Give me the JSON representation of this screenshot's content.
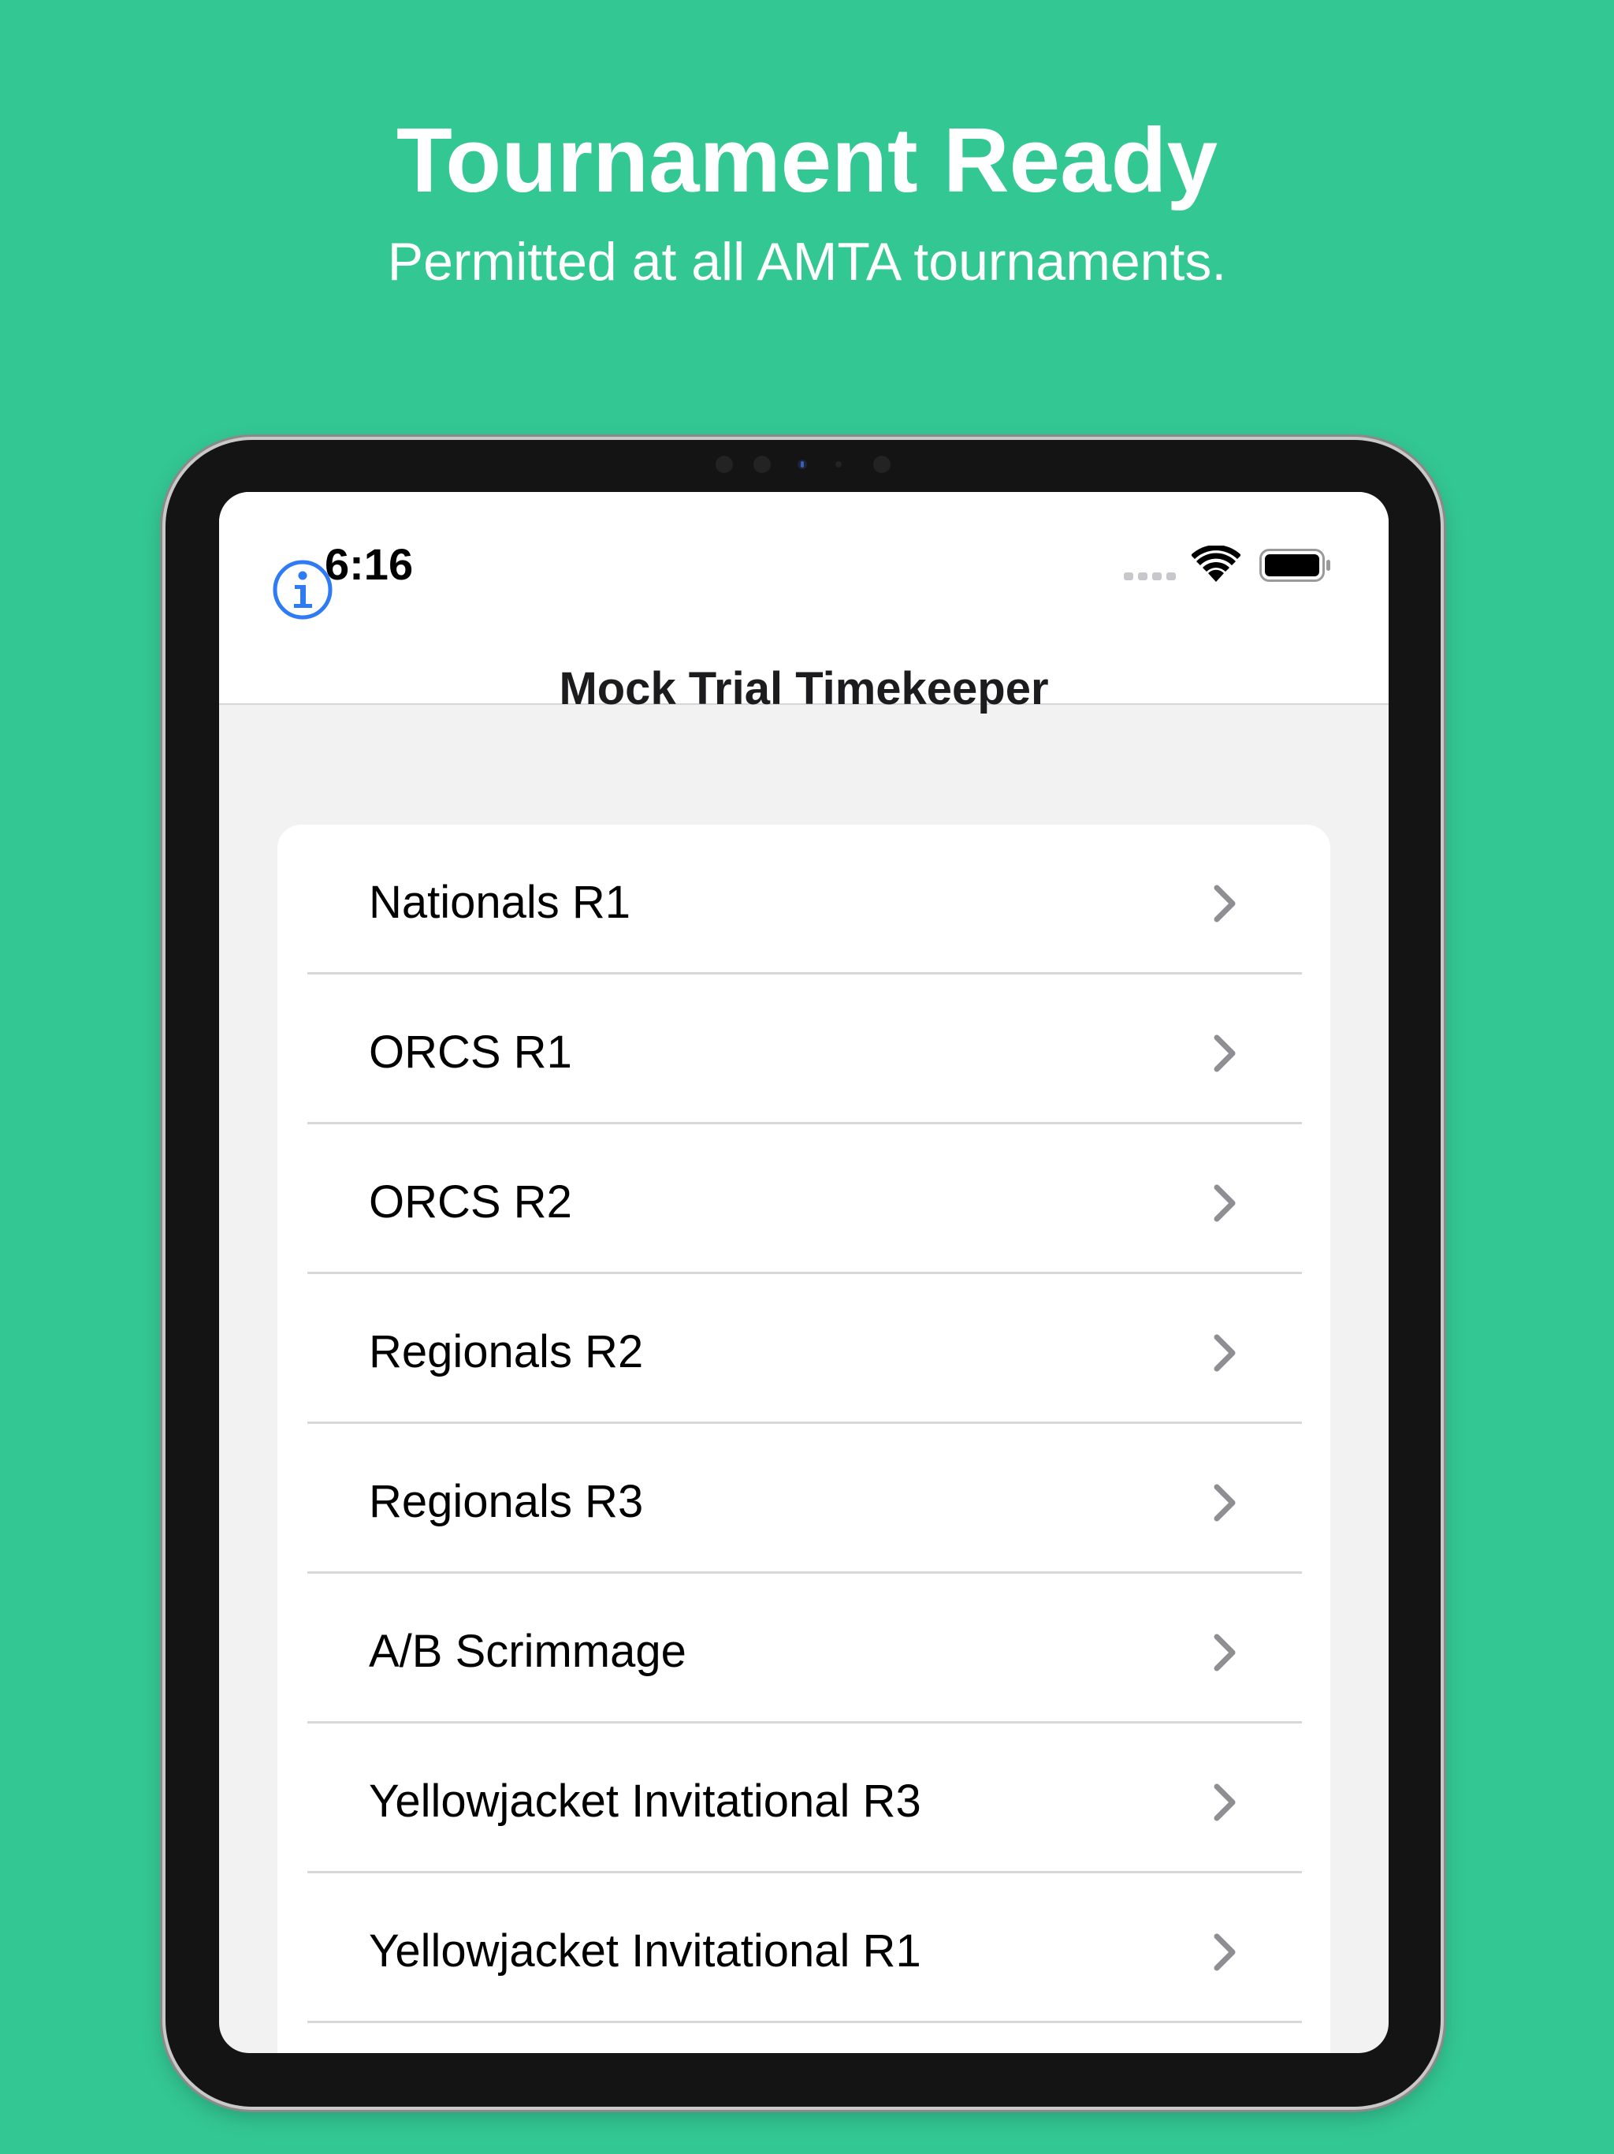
{
  "promo": {
    "title": "Tournament Ready",
    "subtitle": "Permitted at all AMTA tournaments."
  },
  "status_bar": {
    "time": "6:16",
    "icons": [
      "cellular-signal-icon",
      "wifi-icon",
      "battery-icon"
    ]
  },
  "nav_bar": {
    "title": "Mock Trial Timekeeper",
    "left_icon": "info-icon"
  },
  "tournaments": [
    {
      "label": "Nationals R1"
    },
    {
      "label": "ORCS R1"
    },
    {
      "label": "ORCS R2"
    },
    {
      "label": "Regionals R2"
    },
    {
      "label": "Regionals R3"
    },
    {
      "label": "A/B Scrimmage"
    },
    {
      "label": "Yellowjacket Invitational R3"
    },
    {
      "label": "Yellowjacket Invitational R1"
    }
  ],
  "colors": {
    "background": "#33C794",
    "accent": "#2F7BF5",
    "chevron": "#8E8E93"
  }
}
